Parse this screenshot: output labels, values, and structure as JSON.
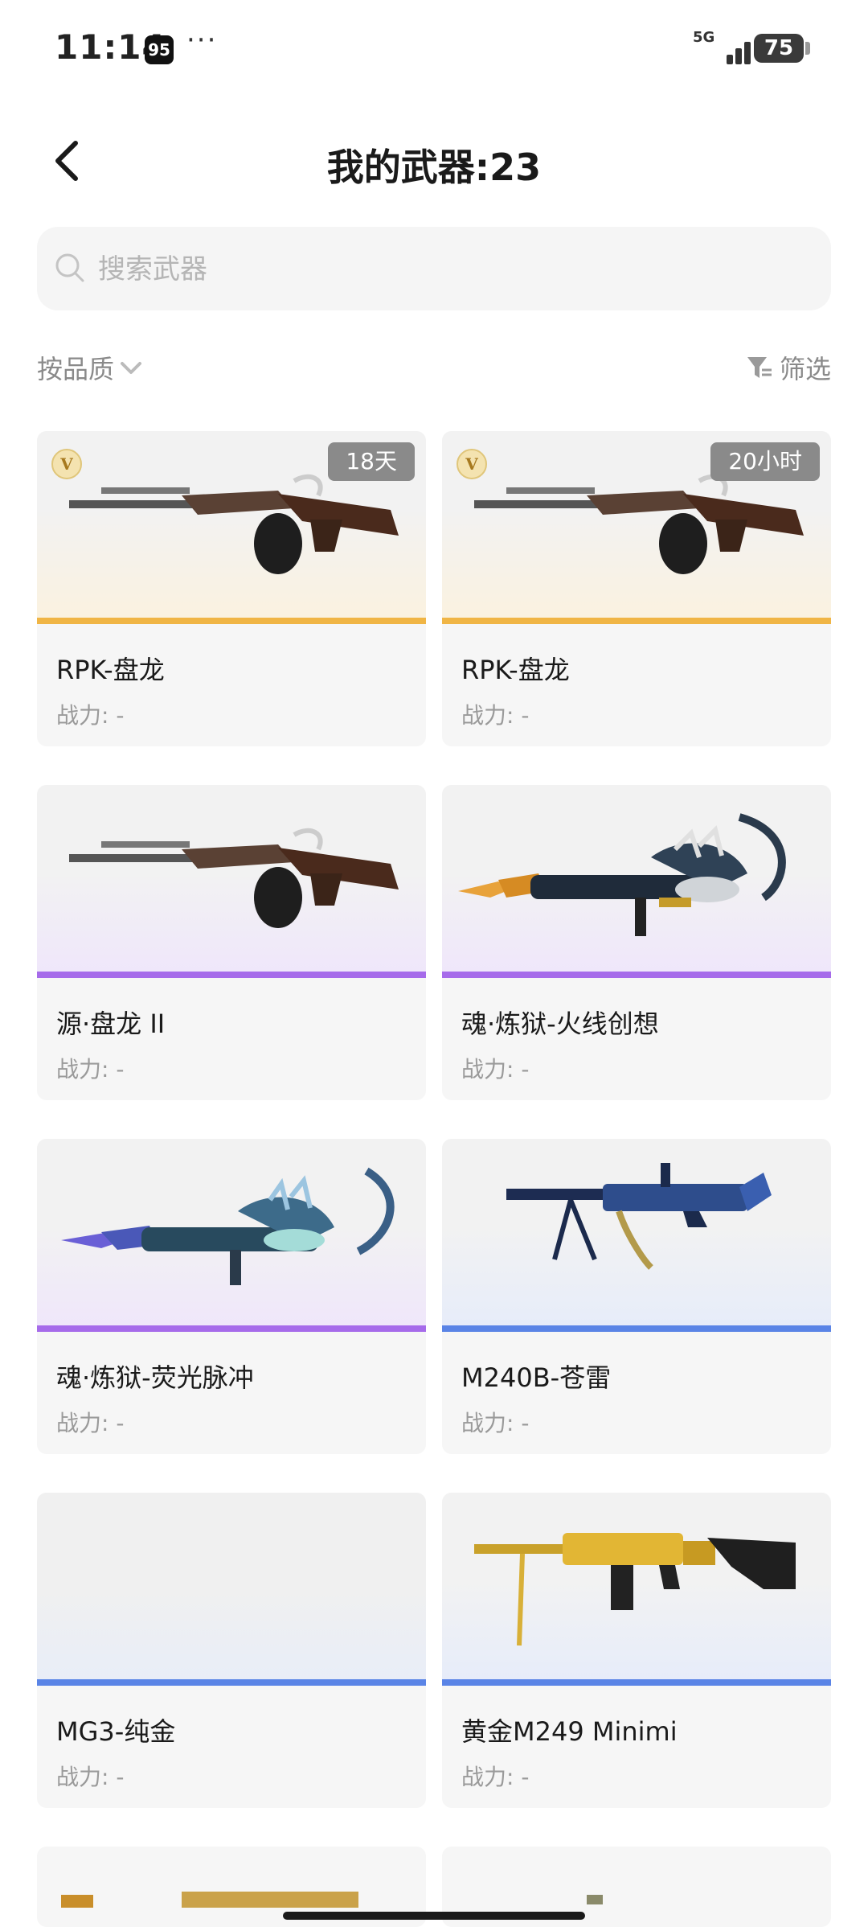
{
  "status_bar": {
    "time": "11:14",
    "app_badge": "95",
    "more": "···",
    "network": "5G",
    "battery": "75"
  },
  "header": {
    "title": "我的武器:23"
  },
  "search": {
    "placeholder": "搜索武器"
  },
  "filters": {
    "sort_label": "按品质",
    "filter_label": "筛选"
  },
  "colors": {
    "gold": "#f0b545",
    "purple": "#a66bea",
    "blue": "#5a84e6",
    "card_bg": "#f6f6f6"
  },
  "weapons": [
    {
      "name": "RPK-盘龙",
      "power": "战力: -",
      "badge": "V",
      "time_left": "18天",
      "rarity": "gold",
      "icon": "rpk-dragon-icon"
    },
    {
      "name": "RPK-盘龙",
      "power": "战力: -",
      "badge": "V",
      "time_left": "20小时",
      "rarity": "gold",
      "icon": "rpk-dragon-icon"
    },
    {
      "name": "源·盘龙 II",
      "power": "战力: -",
      "rarity": "purple",
      "icon": "rpk-dragon-icon"
    },
    {
      "name": "魂·炼狱-火线创想",
      "power": "战力: -",
      "rarity": "purple",
      "icon": "purgatory-gun-icon"
    },
    {
      "name": "魂·炼狱-荧光脉冲",
      "power": "战力: -",
      "rarity": "purple",
      "icon": "purgatory-gun-blue-icon"
    },
    {
      "name": "M240B-苍雷",
      "power": "战力: -",
      "rarity": "blue",
      "icon": "m240b-icon"
    },
    {
      "name": "MG3-纯金",
      "power": "战力: -",
      "rarity": "blue",
      "icon": "empty-image"
    },
    {
      "name": "黄金M249 Minimi",
      "power": "战力: -",
      "rarity": "blue",
      "icon": "m249-gold-icon"
    }
  ]
}
